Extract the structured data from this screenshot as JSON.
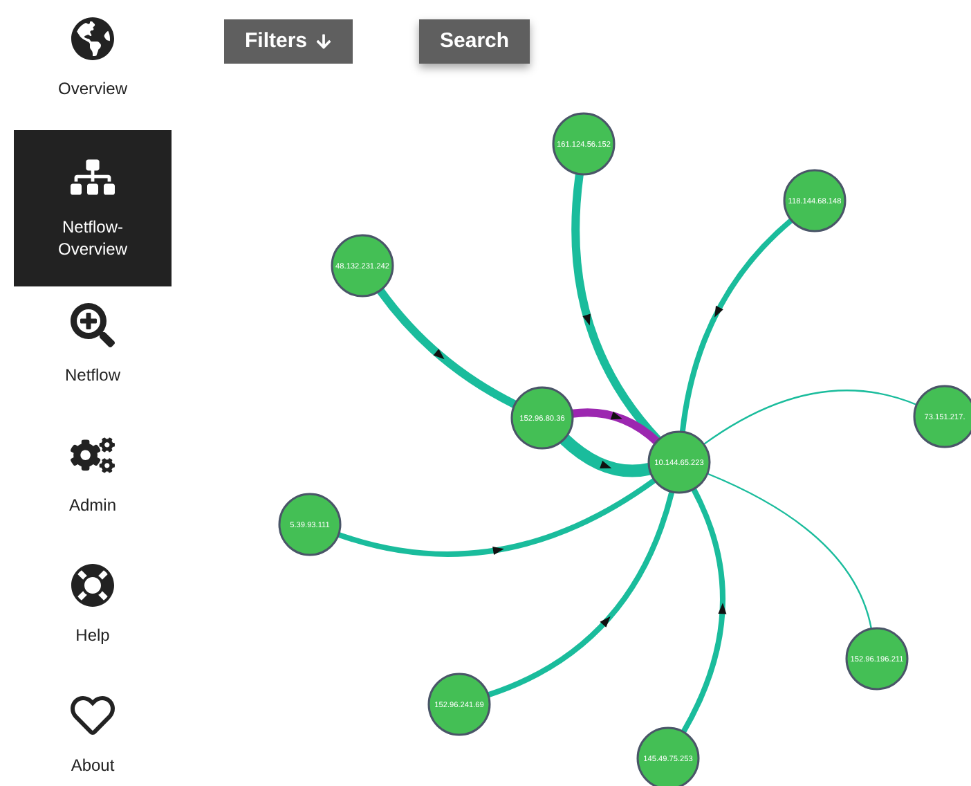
{
  "sidebar": {
    "items": [
      {
        "label": "Overview",
        "selected": false
      },
      {
        "label": "Netflow-Overview",
        "selected": true
      },
      {
        "label": "Netflow",
        "selected": false
      },
      {
        "label": "Admin",
        "selected": false
      },
      {
        "label": "Help",
        "selected": false
      },
      {
        "label": "About",
        "selected": false
      }
    ]
  },
  "toolbar": {
    "buttons": [
      {
        "label": "Filters",
        "raised": false
      },
      {
        "label": "Search",
        "raised": true
      }
    ]
  },
  "graph": {
    "nodes": [
      {
        "label": "161.124.56.152"
      },
      {
        "label": "118.144.68.148"
      },
      {
        "label": "48.132.231.242"
      },
      {
        "label": "152.96.80.36"
      },
      {
        "label": "10.144.65.223"
      },
      {
        "label": "73.151.217."
      },
      {
        "label": "5.39.93.111"
      },
      {
        "label": "152.96.196.211"
      },
      {
        "label": "152.96.241.69"
      },
      {
        "label": "145.49.75.253"
      }
    ],
    "edges": [
      {
        "kind": "thick",
        "color": "#1abc9c"
      },
      {
        "kind": "medium",
        "color": "#1abc9c"
      },
      {
        "kind": "thick",
        "color": "#1abc9c"
      },
      {
        "kind": "heavy",
        "color": "#1abc9c"
      },
      {
        "kind": "thick",
        "color": "#9c27b0"
      },
      {
        "kind": "thin",
        "color": "#1abc9c"
      },
      {
        "kind": "medium",
        "color": "#1abc9c"
      },
      {
        "kind": "thin",
        "color": "#1abc9c"
      },
      {
        "kind": "medium",
        "color": "#1abc9c"
      },
      {
        "kind": "medium",
        "color": "#1abc9c"
      }
    ]
  }
}
